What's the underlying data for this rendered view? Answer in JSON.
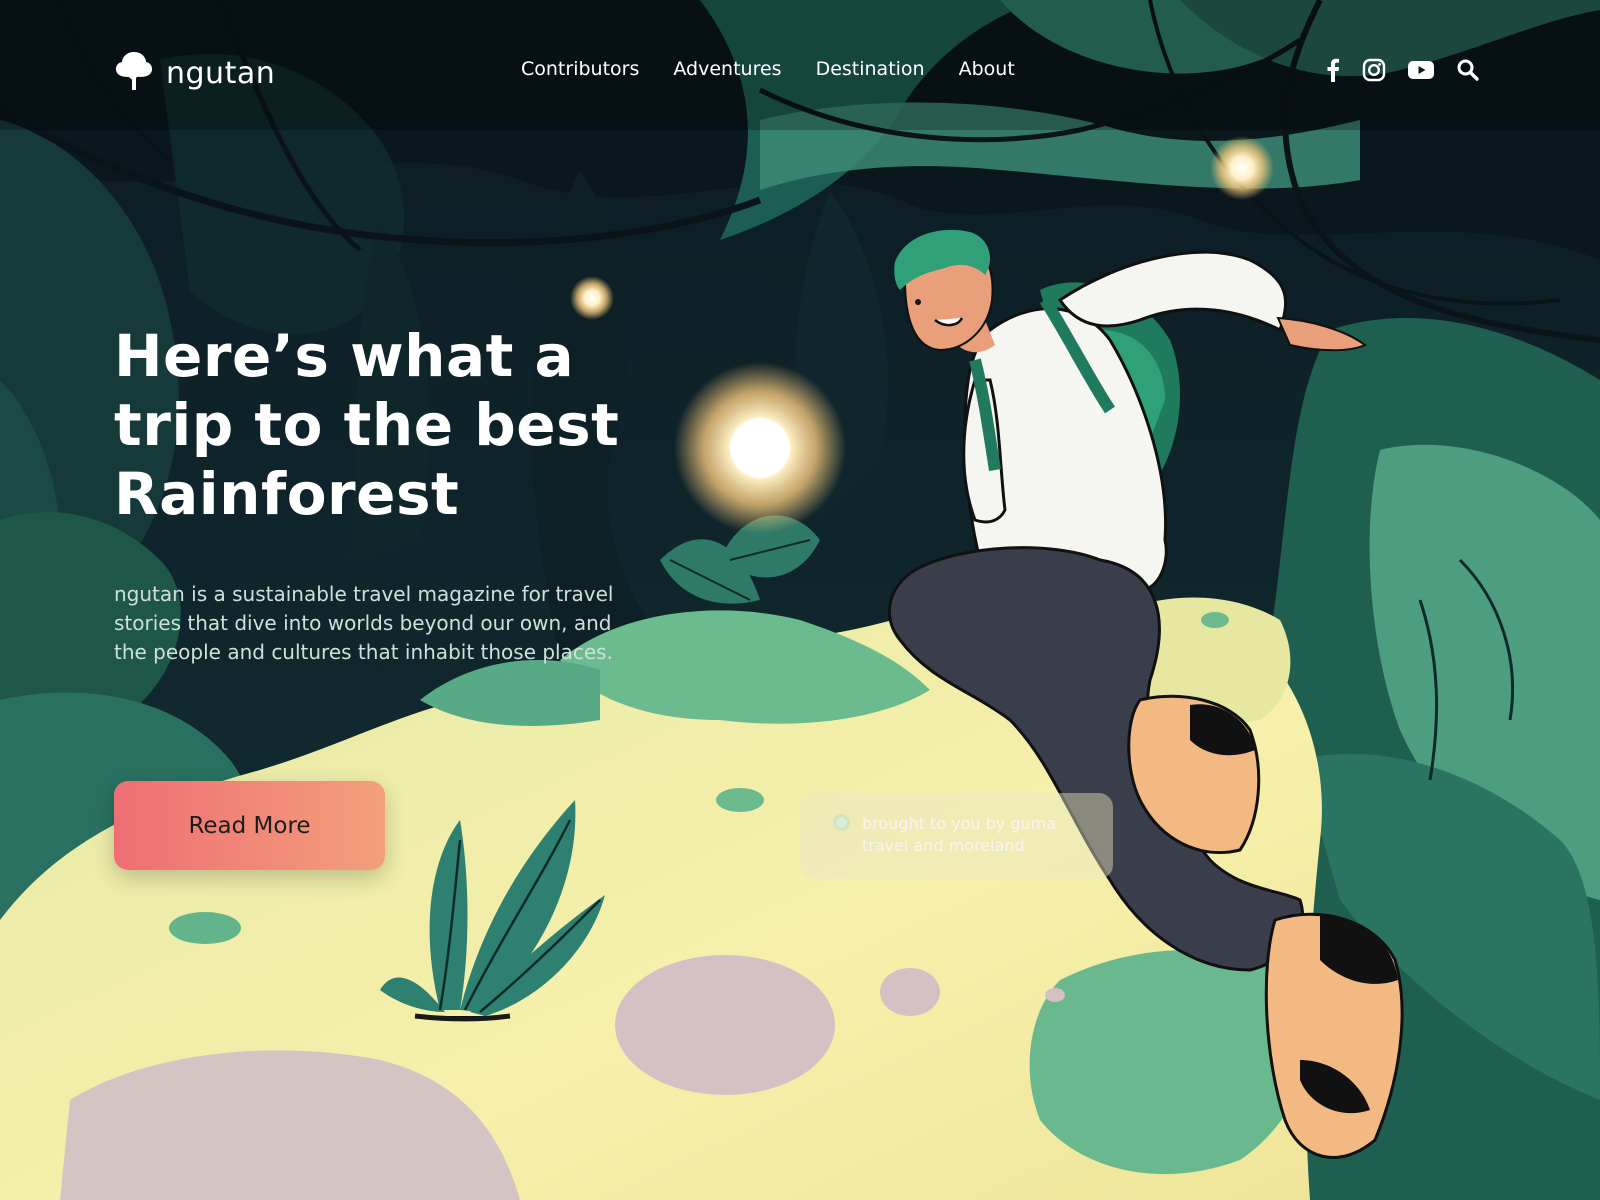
{
  "brand": {
    "name": "ngutan",
    "logo_icon": "tree-icon"
  },
  "nav": {
    "links": [
      {
        "label": "Contributors"
      },
      {
        "label": "Adventures"
      },
      {
        "label": "Destination"
      },
      {
        "label": "About"
      }
    ],
    "icons": [
      "facebook-icon",
      "instagram-icon",
      "youtube-icon",
      "search-icon"
    ]
  },
  "hero": {
    "title": "Here’s what a\ntrip to the best\nRainforest",
    "description": "ngutan is a sustainable travel magazine for travel stories that dive into worlds beyond our own, and the people and cultures that inhabit those places.",
    "cta_label": "Read More"
  },
  "credit": {
    "text": "brought to you by guma travel and moreland"
  },
  "colors": {
    "cta_start": "#ee6e74",
    "cta_end": "#f3a07a",
    "forest_dark": "#0d2a2c",
    "forest_green": "#1f5a4b",
    "ground_yellow": "#f4efaa",
    "skin": "#e9a07a"
  }
}
